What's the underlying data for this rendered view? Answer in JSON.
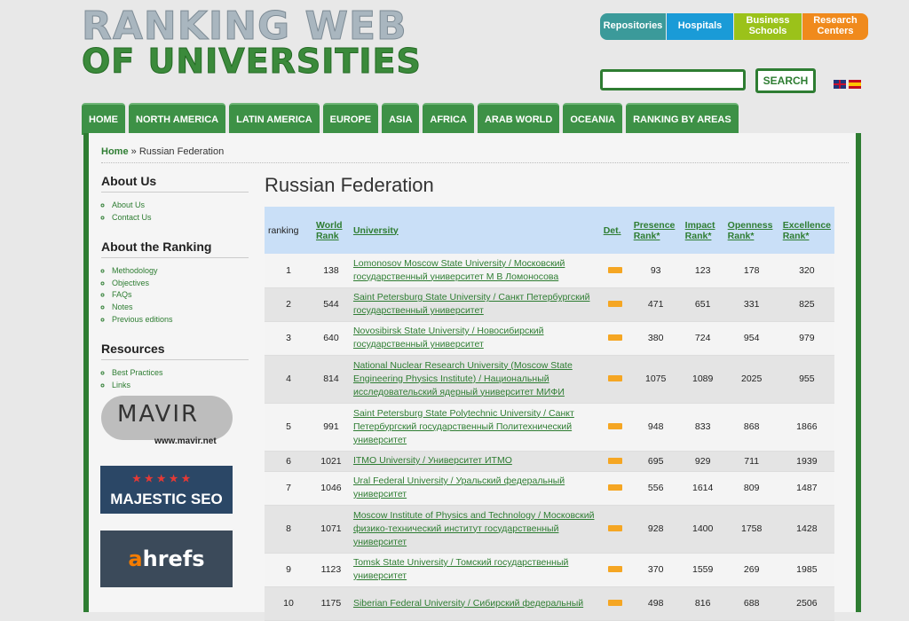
{
  "logo": {
    "line1": "RANKING WEB",
    "line2": "OF UNIVERSITIES"
  },
  "categories": [
    "Repositories",
    "Hospitals",
    "Business Schools",
    "Research Centers"
  ],
  "search": {
    "button": "SEARCH",
    "placeholder": ""
  },
  "nav": [
    "HOME",
    "NORTH AMERICA",
    "LATIN AMERICA",
    "EUROPE",
    "ASIA",
    "AFRICA",
    "ARAB WORLD",
    "OCEANIA",
    "RANKING BY AREAS"
  ],
  "breadcrumb": {
    "home": "Home",
    "sep": "»",
    "current": "Russian Federation"
  },
  "sidebar": {
    "about_us": {
      "title": "About Us",
      "items": [
        "About Us",
        "Contact Us"
      ]
    },
    "about_ranking": {
      "title": "About the Ranking",
      "items": [
        "Methodology",
        "Objectives",
        "FAQs",
        "Notes",
        "Previous editions"
      ]
    },
    "resources": {
      "title": "Resources",
      "items": [
        "Best Practices",
        "Links"
      ]
    }
  },
  "sponsors": {
    "mavir": "MAVIR",
    "mavir_url": "www.mavir.net",
    "majestic": "MAJESTIC SEO",
    "ahrefs_a": "a",
    "ahrefs_rest": "hrefs"
  },
  "page_title": "Russian Federation",
  "table": {
    "headers": {
      "ranking": "ranking",
      "world_rank": "World Rank",
      "university": "University",
      "det": "Det.",
      "presence": "Presence Rank*",
      "impact": "Impact Rank*",
      "openness": "Openness Rank*",
      "excellence": "Excellence Rank*"
    },
    "rows": [
      {
        "rank": "1",
        "world": "138",
        "name": "Lomonosov Moscow State University / Московский государственный университет М В Ломоносова",
        "presence": "93",
        "impact": "123",
        "openness": "178",
        "excellence": "320"
      },
      {
        "rank": "2",
        "world": "544",
        "name": "Saint Petersburg State University / Санкт Петербургский государственный университет",
        "presence": "471",
        "impact": "651",
        "openness": "331",
        "excellence": "825"
      },
      {
        "rank": "3",
        "world": "640",
        "name": "Novosibirsk State University / Новосибирский государственный университет",
        "presence": "380",
        "impact": "724",
        "openness": "954",
        "excellence": "979"
      },
      {
        "rank": "4",
        "world": "814",
        "name": "National Nuclear Research University (Moscow State Engineering Physics Institute) / Национальный исследовательский ядерный университет МИФИ",
        "presence": "1075",
        "impact": "1089",
        "openness": "2025",
        "excellence": "955"
      },
      {
        "rank": "5",
        "world": "991",
        "name": "Saint Petersburg State Polytechnic University / Санкт Петербургский государственный Политехнический университет",
        "presence": "948",
        "impact": "833",
        "openness": "868",
        "excellence": "1866"
      },
      {
        "rank": "6",
        "world": "1021",
        "name": "ITMO University / Университет ИТМО",
        "presence": "695",
        "impact": "929",
        "openness": "711",
        "excellence": "1939"
      },
      {
        "rank": "7",
        "world": "1046",
        "name": "Ural Federal University / Уральский федеральный университет",
        "presence": "556",
        "impact": "1614",
        "openness": "809",
        "excellence": "1487"
      },
      {
        "rank": "8",
        "world": "1071",
        "name": "Moscow Institute of Physics and Technology / Московский физико-технический институт государственный университет",
        "presence": "928",
        "impact": "1400",
        "openness": "1758",
        "excellence": "1428"
      },
      {
        "rank": "9",
        "world": "1123",
        "name": "Tomsk State University / Томский государственный университет",
        "presence": "370",
        "impact": "1559",
        "openness": "269",
        "excellence": "1985"
      },
      {
        "rank": "10",
        "world": "1175",
        "name": "Siberian Federal University / Сибирский федеральный",
        "presence": "498",
        "impact": "816",
        "openness": "688",
        "excellence": "2506"
      }
    ]
  }
}
